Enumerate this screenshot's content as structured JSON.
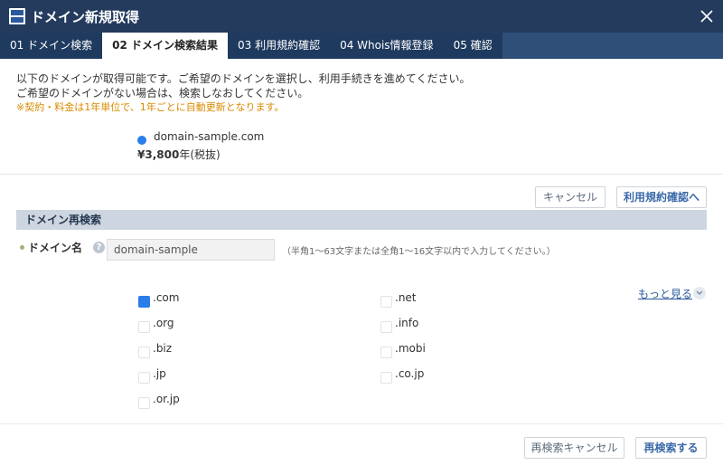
{
  "window": {
    "title": "ドメイン新規取得"
  },
  "tabs": [
    {
      "label": "01 ドメイン検索",
      "active": false
    },
    {
      "label": "02 ドメイン検索結果",
      "active": true
    },
    {
      "label": "03 利用規約確認",
      "active": false
    },
    {
      "label": "04 Whois情報登録",
      "active": false
    },
    {
      "label": "05 確認",
      "active": false
    }
  ],
  "intro": {
    "line1": "以下のドメインが取得可能です。ご希望のドメインを選択し、利用手続きを進めてください。",
    "line2": "ご希望のドメインがない場合は、検索しなおしてください。",
    "notice": "※契約・料金は1年単位で、1年ごとに自動更新となります。"
  },
  "result": {
    "domain": "domain-sample.com",
    "price": "¥3,800",
    "price_suffix": "年(税抜)",
    "selected": true
  },
  "actions": {
    "cancel": "キャンセル",
    "next": "利用規約確認へ"
  },
  "research": {
    "section_title": "ドメイン再検索",
    "field_label": "ドメイン名",
    "input_value": "domain-sample",
    "hint": "（半角1～63文字または全角1～16文字以内で入力してください。）",
    "more_link": "もっと見る",
    "tlds": [
      {
        "label": ".com",
        "checked": true
      },
      {
        "label": ".net",
        "checked": false
      },
      {
        "label": ".org",
        "checked": false
      },
      {
        "label": ".info",
        "checked": false
      },
      {
        "label": ".biz",
        "checked": false
      },
      {
        "label": ".mobi",
        "checked": false
      },
      {
        "label": ".jp",
        "checked": false
      },
      {
        "label": ".co.jp",
        "checked": false
      },
      {
        "label": ".or.jp",
        "checked": false
      }
    ],
    "cancel_button": "再検索キャンセル",
    "search_button": "再検索する"
  },
  "colors": {
    "titlebar": "#243b5e",
    "tabbar": "#1f3a5f",
    "accent": "#2b7de9",
    "notice": "#d98a00",
    "section_bar": "#cdd6e0"
  }
}
